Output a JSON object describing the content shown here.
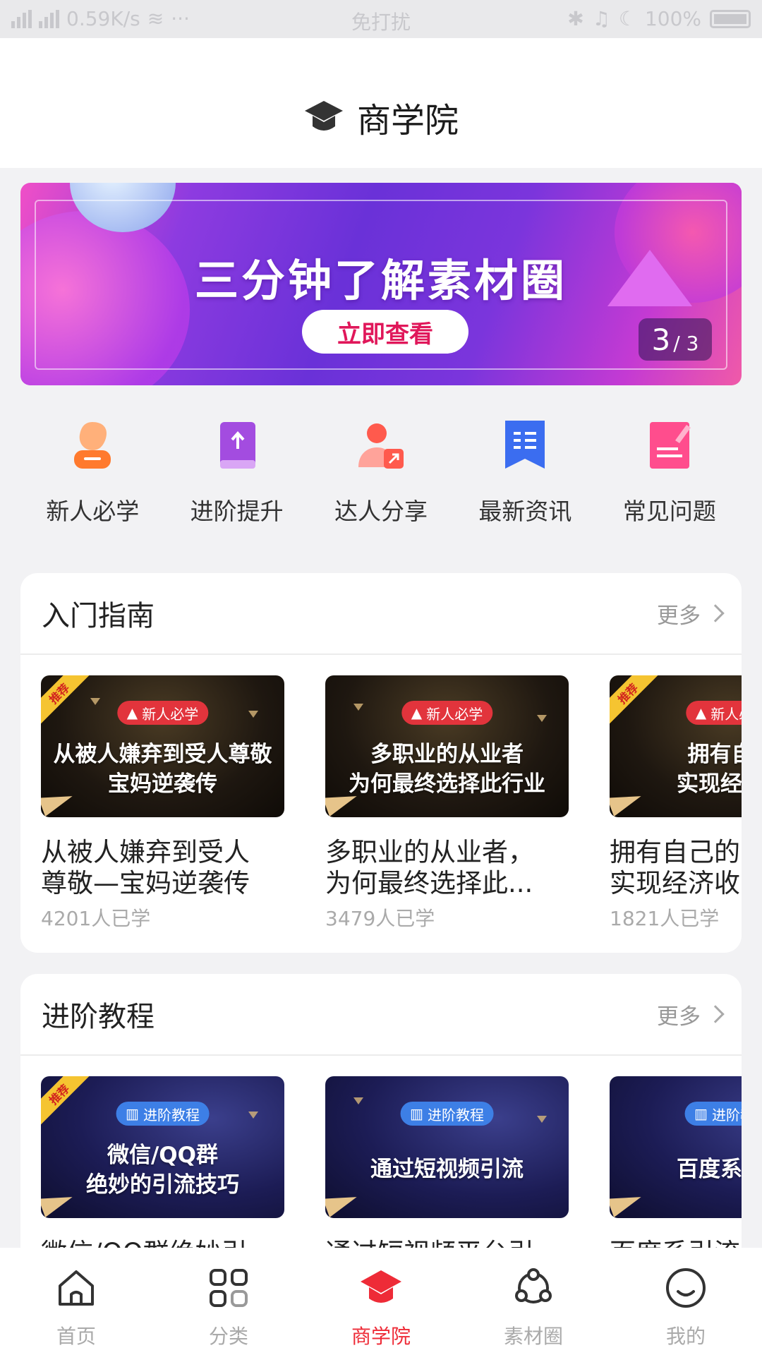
{
  "status_bar": {
    "net1": "2G",
    "net2": "4G",
    "speed": "0.59K/s",
    "dots": "···",
    "mode": "免打扰",
    "battery": "100%"
  },
  "header": {
    "title": "商学院",
    "icon": "graduation-cap-icon"
  },
  "banner": {
    "headline": "三分钟了解素材圈",
    "cta": "立即查看",
    "page_current": "3",
    "page_total": "/ 3"
  },
  "quick_nav": [
    {
      "label": "新人必学",
      "icon": "newbie-icon",
      "color": "#ff7a2e"
    },
    {
      "label": "进阶提升",
      "icon": "book-arrow-icon",
      "color": "#a34ce0"
    },
    {
      "label": "达人分享",
      "icon": "user-share-icon",
      "color": "#ff5a4d"
    },
    {
      "label": "最新资讯",
      "icon": "news-bookmark-icon",
      "color": "#3b6df0"
    },
    {
      "label": "常见问题",
      "icon": "notepad-pen-icon",
      "color": "#ff4d8d"
    }
  ],
  "sections": [
    {
      "title": "入门指南",
      "more": "更多",
      "cards": [
        {
          "ribbon": "推荐",
          "tag": "新人必学",
          "line1": "从被人嫌弃到受人尊敬",
          "line2": "宝妈逆袭传",
          "title": "从被人嫌弃到受人\n尊敬—宝妈逆袭传",
          "meta": "4201人已学"
        },
        {
          "ribbon": "",
          "tag": "新人必学",
          "line1": "多职业的从业者",
          "line2": "为何最终选择此行业",
          "title": "多职业的从业者，\n为何最终选择此...",
          "meta": "3479人已学"
        },
        {
          "ribbon": "推荐",
          "tag": "新人必学",
          "line1": "拥有自己",
          "line2": "实现经济收",
          "title": "拥有自己的\n实现经济收",
          "meta": "1821人已学"
        }
      ]
    },
    {
      "title": "进阶教程",
      "more": "更多",
      "cards": [
        {
          "ribbon": "推荐",
          "tag": "进阶教程",
          "line1": "微信/QQ群",
          "line2": "绝妙的引流技巧",
          "title": "微信/QQ群绝妙引",
          "meta": ""
        },
        {
          "ribbon": "",
          "tag": "进阶教程",
          "line1": "通过短视频引流",
          "line2": "",
          "title": "通过短视频平台引",
          "meta": ""
        },
        {
          "ribbon": "",
          "tag": "进阶教程",
          "line1": "百度系引流",
          "line2": "",
          "title": "百度系引流",
          "meta": ""
        }
      ]
    }
  ],
  "tab_bar": [
    {
      "label": "首页",
      "icon": "home-icon",
      "active": false
    },
    {
      "label": "分类",
      "icon": "grid-icon",
      "active": false
    },
    {
      "label": "商学院",
      "icon": "graduation-cap-icon",
      "active": true
    },
    {
      "label": "素材圈",
      "icon": "circle-nodes-icon",
      "active": false
    },
    {
      "label": "我的",
      "icon": "smile-face-icon",
      "active": false
    }
  ],
  "colors": {
    "accent": "#ee2b37",
    "text_muted": "#aaaaaa"
  }
}
